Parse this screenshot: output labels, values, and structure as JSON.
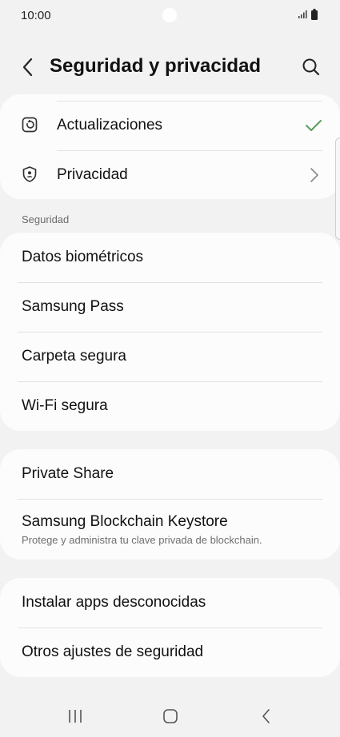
{
  "status_bar": {
    "time": "10:00"
  },
  "header": {
    "title": "Seguridad y privacidad"
  },
  "top_group": [
    {
      "label": "Actualizaciones",
      "icon": "update-icon",
      "trailing": "check-icon"
    },
    {
      "label": "Privacidad",
      "icon": "privacy-shield-icon",
      "trailing": "chevron-right-icon"
    }
  ],
  "security_section": {
    "label": "Seguridad",
    "items": [
      {
        "label": "Datos biométricos"
      },
      {
        "label": "Samsung Pass"
      },
      {
        "label": "Carpeta segura"
      },
      {
        "label": "Wi-Fi segura"
      }
    ]
  },
  "share_group": [
    {
      "label": "Private Share"
    },
    {
      "label": "Samsung Blockchain Keystore",
      "sublabel": "Protege y administra tu clave privada de blockchain."
    }
  ],
  "other_group": [
    {
      "label": "Instalar apps desconocidas"
    },
    {
      "label": "Otros ajustes de seguridad"
    }
  ],
  "colors": {
    "check": "#5a9d5e",
    "background": "#f2f2f2",
    "card": "#fcfcfc"
  }
}
